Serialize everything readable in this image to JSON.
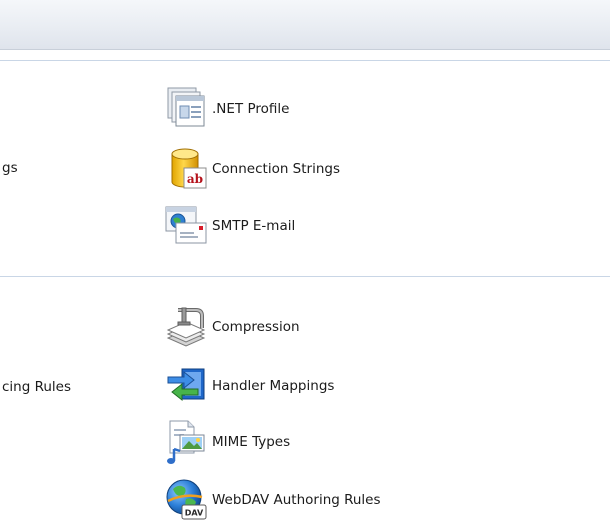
{
  "sections": [
    {
      "group_label": "gs",
      "items": [
        {
          "label": ".NET Profile",
          "icon": "net-profile-icon"
        },
        {
          "label": "Connection Strings",
          "icon": "database-ab-icon"
        },
        {
          "label": "SMTP E-mail",
          "icon": "email-globe-icon"
        }
      ]
    },
    {
      "group_label": "cing Rules",
      "items": [
        {
          "label": "Compression",
          "icon": "clamp-compression-icon"
        },
        {
          "label": "Handler Mappings",
          "icon": "arrows-mapping-icon"
        },
        {
          "label": "MIME Types",
          "icon": "mime-document-icon"
        },
        {
          "label": "WebDAV Authoring Rules",
          "icon": "webdav-globe-icon"
        }
      ]
    }
  ],
  "colors": {
    "separator": "#c9d6e6",
    "topbar": "#e8ecf2",
    "text": "#1b1b1b"
  }
}
